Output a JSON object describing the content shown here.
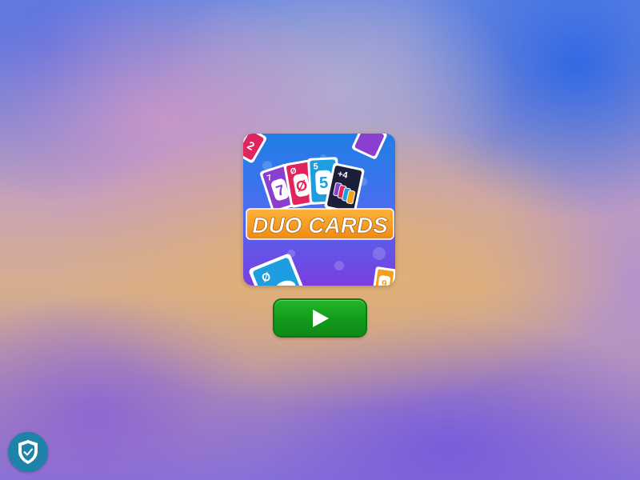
{
  "game": {
    "title": "DUO CARDS",
    "cards": {
      "top_left": "2",
      "fan": [
        "7",
        "Ø",
        "5",
        "+4"
      ],
      "fan_big": [
        "7",
        "Ø",
        "5"
      ],
      "bottom_left": "Ø",
      "bottom_right": "9"
    }
  },
  "play_button": {
    "icon": "play-icon",
    "color": "#139a1c"
  },
  "badge": {
    "icon": "shield-check-icon",
    "color": "#1f82a8"
  },
  "colors": {
    "title_banner": "#f39a1e",
    "card_purple": "#8b3fd0",
    "card_red": "#e0245e",
    "card_blue": "#1e9de0",
    "card_black": "#1c1f3a",
    "card_orange": "#f2a11d"
  }
}
